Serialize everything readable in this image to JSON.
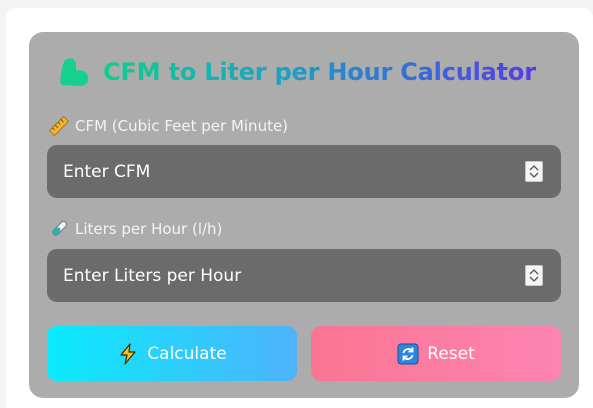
{
  "title": "CFM to Liter per Hour Calculator",
  "cfm": {
    "label": "CFM (Cubic Feet per Minute)",
    "placeholder": "Enter CFM",
    "icon": "ruler-icon"
  },
  "lph": {
    "label": "Liters per Hour (l/h)",
    "placeholder": "Enter Liters per Hour",
    "icon": "test-tube-icon"
  },
  "buttons": {
    "calculate": "Calculate",
    "reset": "Reset"
  },
  "colors": {
    "card": "#acacac",
    "field": "#6b6b6b",
    "calc_start": "#08ecfd",
    "calc_end": "#4fb2fb",
    "reset_start": "#fb7592",
    "reset_end": "#fc84b2",
    "title_start": "#0fcf8c",
    "title_end": "#5a3ae8"
  }
}
